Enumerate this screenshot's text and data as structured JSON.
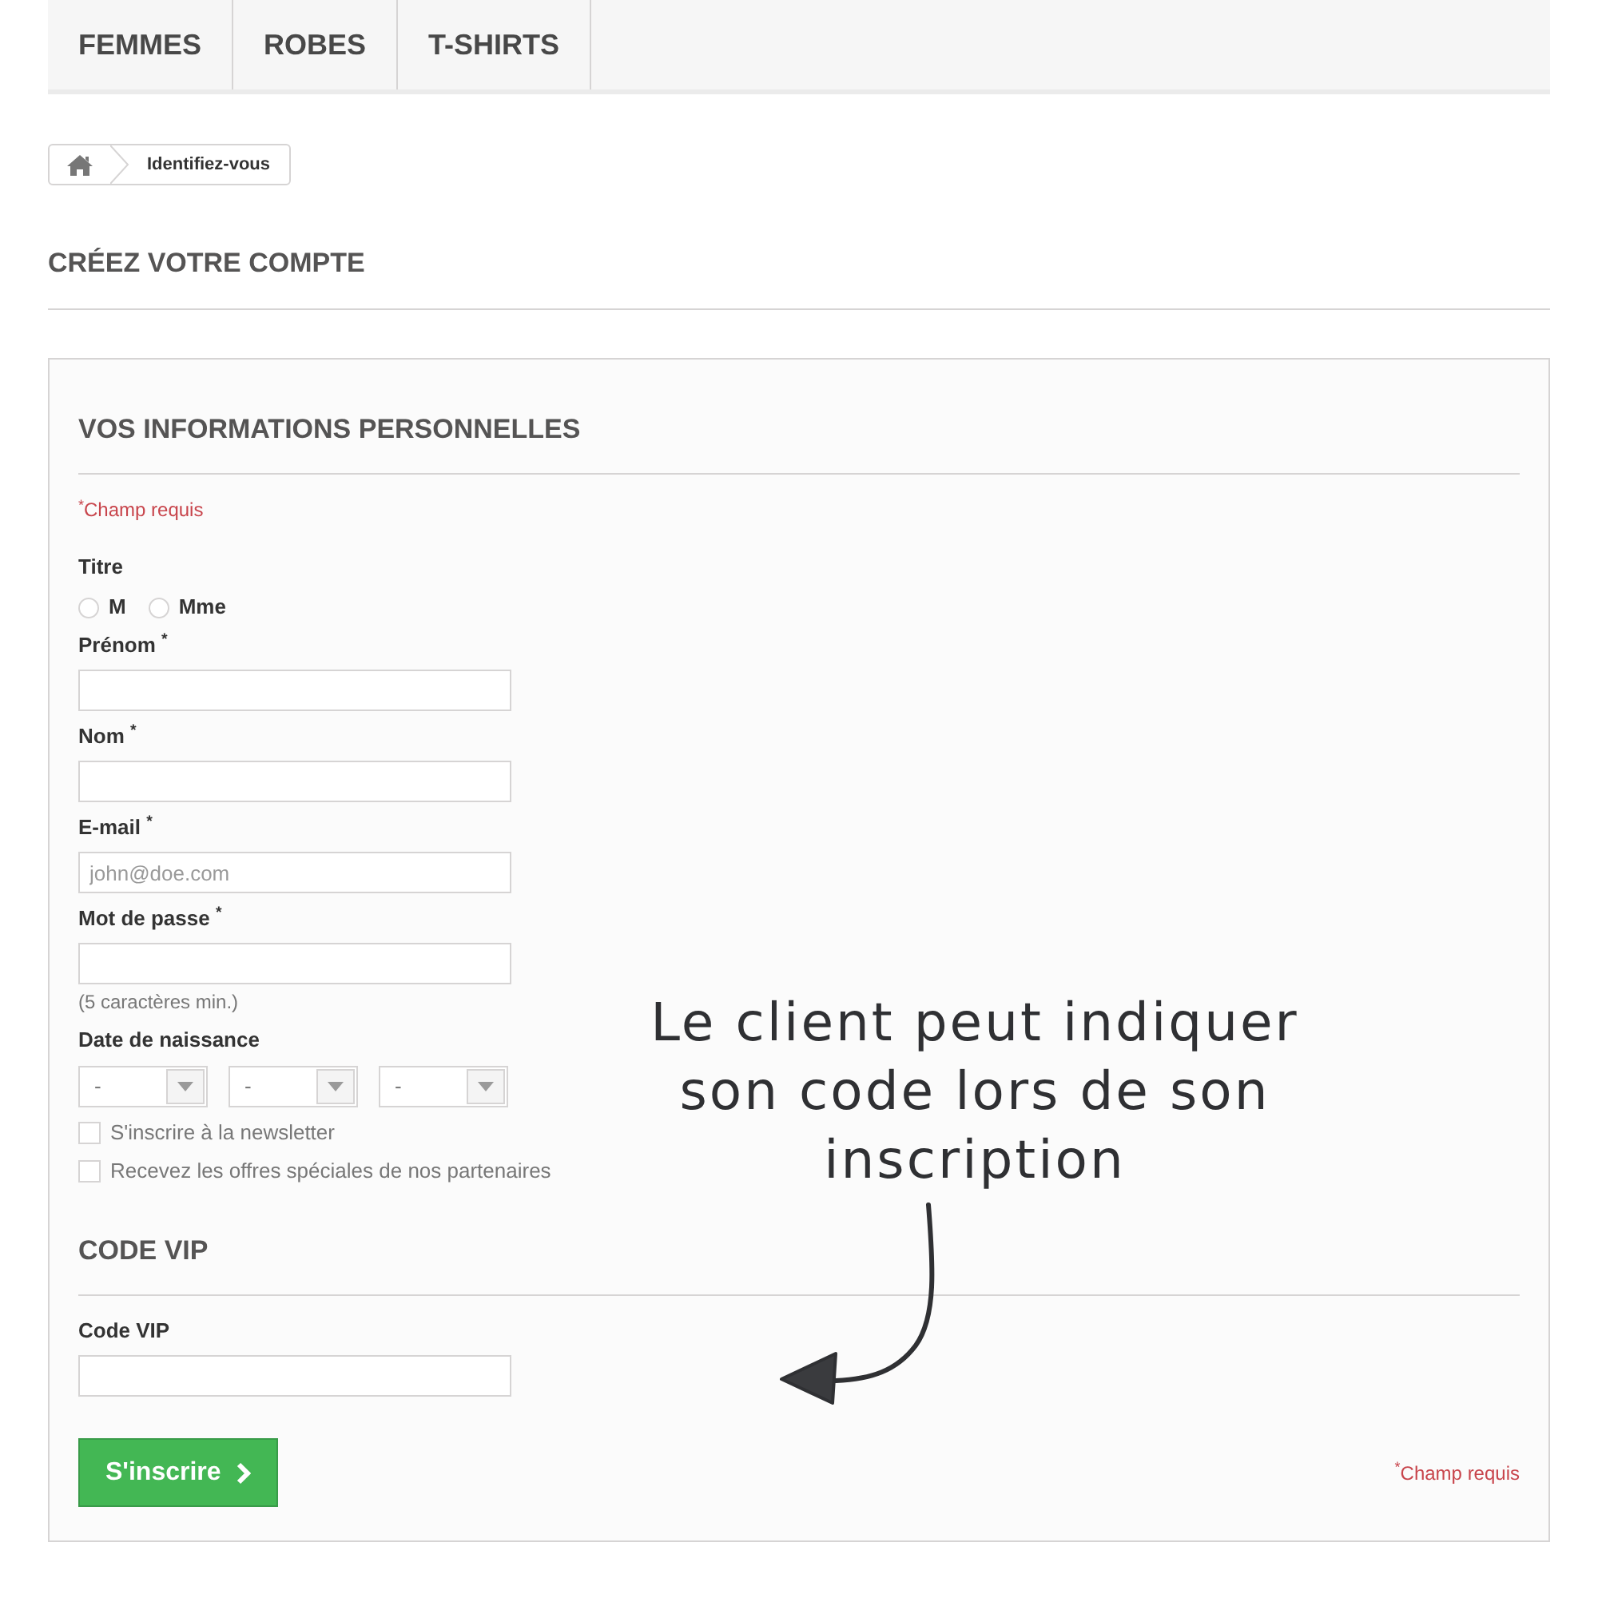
{
  "nav": {
    "tabs": [
      {
        "label": "FEMMES"
      },
      {
        "label": "ROBES"
      },
      {
        "label": "T-SHIRTS"
      }
    ]
  },
  "breadcrumb": {
    "current": "Identifiez-vous"
  },
  "page_title": "CRÉEZ VOTRE COMPTE",
  "form": {
    "sections": [
      {
        "title": "VOS INFORMATIONS PERSONNELLES",
        "required_note": "$^{*}$Champ requis",
        "fields": [
          {
            "kind": "radio",
            "label": "Titre",
            "options": [
              {
                "label": "M",
                "selected": false
              },
              {
                "label": "Mme",
                "selected": false
              }
            ]
          },
          {
            "kind": "text",
            "label": "Prénom $^{*}$"
          },
          {
            "kind": "text",
            "label": "Nom $^{*}$"
          },
          {
            "kind": "text",
            "label": "E-mail $^{*}$",
            "placeholder": "john@doe.com"
          },
          {
            "kind": "text",
            "label": "Mot de passe $^{*}$",
            "hint": "(5 caractères min.)"
          },
          {
            "kind": "date",
            "label": "Date de naissance",
            "selects": [
              {
                "value": "-"
              },
              {
                "value": "-"
              },
              {
                "value": "-"
              }
            ]
          },
          {
            "kind": "checkbox",
            "label": "S'inscrire à la newsletter",
            "checked": false
          },
          {
            "kind": "checkbox",
            "label": "Recevez les offres spéciales de nos partenaires",
            "checked": false
          }
        ]
      },
      {
        "title": "CODE VIP",
        "fields": [
          {
            "kind": "text",
            "label": "Code VIP"
          }
        ]
      }
    ],
    "submit": {
      "label": "S'inscrire"
    },
    "footer_note": "$^{*}$Champ requis"
  },
  "annotation": {
    "text": "Le client peut indiquer\nson code lors de son\ninscription"
  }
}
